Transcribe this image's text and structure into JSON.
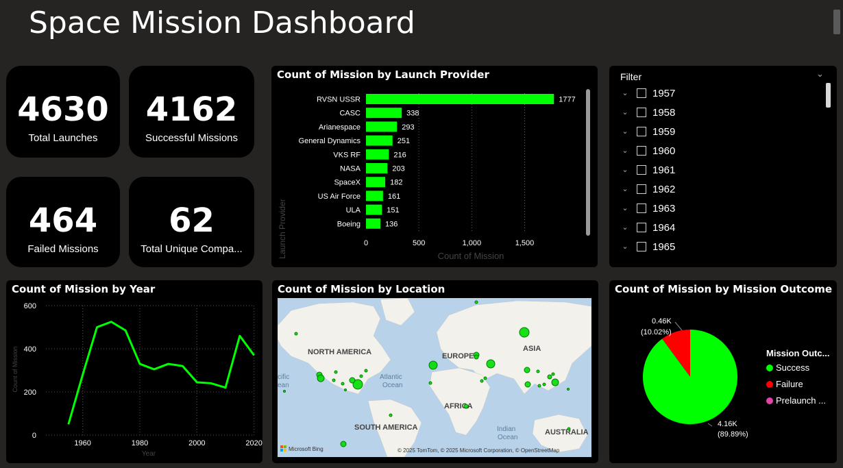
{
  "header": {
    "title": "Space Mission Dashboard"
  },
  "kpis": [
    {
      "value": "4630",
      "label": "Total Launches"
    },
    {
      "value": "4162",
      "label": "Successful Missions"
    },
    {
      "value": "464",
      "label": "Failed Missions"
    },
    {
      "value": "62",
      "label": "Total Unique Compa..."
    }
  ],
  "provider_chart": {
    "title": "Count of Mission by Launch Provider",
    "xlabel": "Count of Mission",
    "ylabel": "Launch Provider",
    "bar_color": "#00FF00"
  },
  "year_chart": {
    "title": "Count of Mission by Year",
    "xlabel": "Year",
    "ylabel": "Count of Mission",
    "line_color": "#00FF00"
  },
  "map": {
    "title": "Count of Mission by Location",
    "labels": {
      "north_america": "NORTH AMERICA",
      "europe": "EUROPE",
      "asia": "ASIA",
      "atlantic": "Atlantic",
      "ocean1": "Ocean",
      "pacific": "cific",
      "pacific2": "ean",
      "africa": "AFRICA",
      "south_america": "SOUTH AMERICA",
      "indian": "Indian",
      "ocean2": "Ocean",
      "australia": "AUSTRALIA"
    },
    "attribution": "© 2025 TomTom, © 2025 Microsoft Corporation, © OpenStreetMap",
    "brand": "Microsoft Bing"
  },
  "filter": {
    "title": "Filter",
    "years": [
      "1957",
      "1958",
      "1959",
      "1960",
      "1961",
      "1962",
      "1963",
      "1964",
      "1965"
    ]
  },
  "outcome_chart": {
    "title": "Count of Mission by Mission Outcome",
    "legend_title": "Mission Outc...",
    "labels": {
      "failure_value": "0.46K",
      "failure_pct": "(10.02%)",
      "success_value": "4.16K",
      "success_pct": "(89.89%)"
    },
    "colors": {
      "success": "#00FF00",
      "failure": "#FF0000",
      "prelaunch": "#E044A7"
    }
  },
  "chart_data": [
    {
      "type": "bar",
      "title": "Count of Mission by Launch Provider",
      "xlabel": "Count of Mission",
      "ylabel": "Launch Provider",
      "categories": [
        "RVSN USSR",
        "CASC",
        "Arianespace",
        "General Dynamics",
        "VKS RF",
        "NASA",
        "SpaceX",
        "US Air Force",
        "ULA",
        "Boeing"
      ],
      "values": [
        1777,
        338,
        293,
        251,
        216,
        203,
        182,
        161,
        151,
        136
      ],
      "xlim": [
        0,
        1800
      ],
      "xticks": [
        0,
        500,
        1000,
        1500
      ],
      "xtick_labels": [
        "0",
        "500",
        "1,000",
        "1,500"
      ],
      "orientation": "horizontal"
    },
    {
      "type": "line",
      "title": "Count of Mission by Year",
      "xlabel": "Year",
      "ylabel": "Count of Mission",
      "x": [
        1955,
        1960,
        1965,
        1970,
        1975,
        1980,
        1985,
        1990,
        1995,
        2000,
        2005,
        2010,
        2015,
        2020
      ],
      "values": [
        50,
        280,
        500,
        525,
        485,
        330,
        305,
        330,
        320,
        245,
        240,
        220,
        460,
        370
      ],
      "ylim": [
        0,
        600
      ],
      "yticks": [
        0,
        200,
        400,
        600
      ],
      "xticks": [
        1960,
        1980,
        2000,
        2020
      ]
    },
    {
      "type": "pie",
      "title": "Count of Mission by Mission Outcome",
      "categories": [
        "Success",
        "Failure",
        "Prelaunch ..."
      ],
      "values": [
        4162,
        464,
        4
      ],
      "percent": [
        89.89,
        10.02,
        0.09
      ]
    }
  ]
}
